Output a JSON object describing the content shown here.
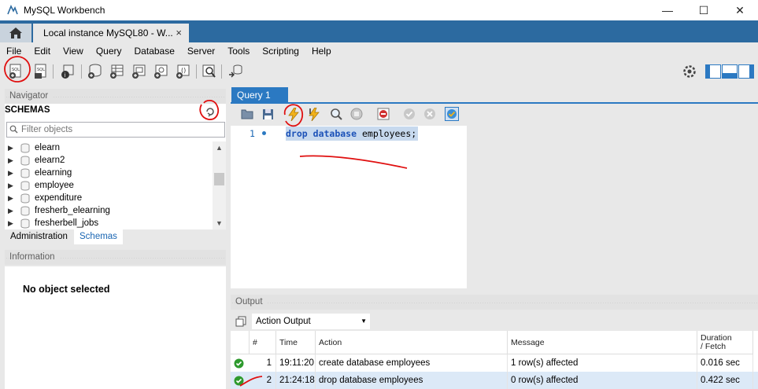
{
  "window": {
    "title": "MySQL Workbench"
  },
  "tabs": {
    "connection_label": "Local instance MySQL80 - W...",
    "close_glyph": "×"
  },
  "menu": [
    "File",
    "Edit",
    "View",
    "Query",
    "Database",
    "Server",
    "Tools",
    "Scripting",
    "Help"
  ],
  "navigator": {
    "header": "Navigator",
    "schemas_title": "SCHEMAS",
    "filter_placeholder": "Filter objects",
    "schemas": [
      "elearn",
      "elearn2",
      "elearning",
      "employee",
      "expenditure",
      "fresherb_elearning",
      "fresherbell_jobs"
    ],
    "tab_administration": "Administration",
    "tab_schemas": "Schemas"
  },
  "information": {
    "header": "Information",
    "message": "No object selected"
  },
  "editor": {
    "tab_label": "Query 1",
    "line_number": "1",
    "code": {
      "keyword1": "drop",
      "keyword2": "database",
      "rest": "employees;"
    }
  },
  "output": {
    "header": "Output",
    "selector_value": "Action Output",
    "columns": {
      "num": "#",
      "time": "Time",
      "action": "Action",
      "message": "Message",
      "duration": "Duration / Fetch"
    },
    "rows": [
      {
        "num": "1",
        "time": "19:11:20",
        "action": "create database employees",
        "message": "1 row(s) affected",
        "duration": "0.016 sec"
      },
      {
        "num": "2",
        "time": "21:24:18",
        "action": "drop database employees",
        "message": "0 row(s) affected",
        "duration": "0.422 sec"
      }
    ]
  },
  "colors": {
    "accent": "#2b79c2",
    "tabstrip": "#2c6aa0",
    "annotation": "#e01010",
    "success": "#2e9a2e"
  }
}
